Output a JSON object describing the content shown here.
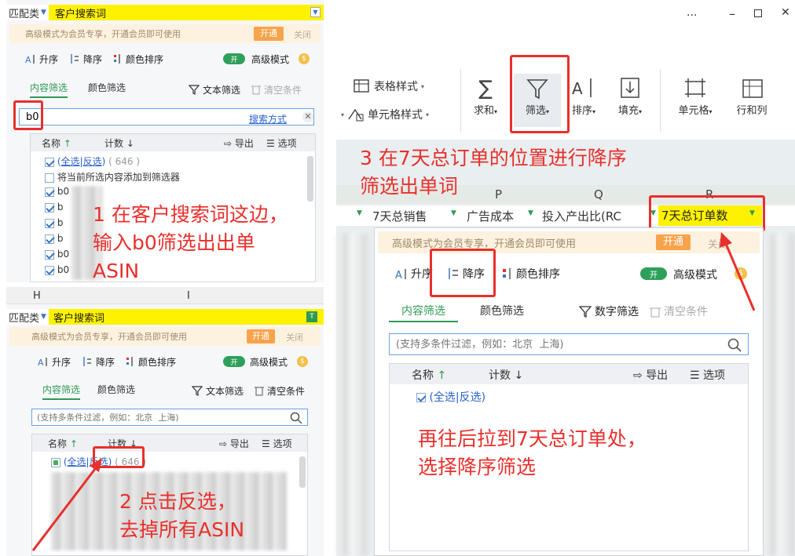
{
  "panel1": {
    "header_left": "匹配类",
    "header_title": "客户搜索词",
    "vip_text": "高级模式为会员专享，开通会员即可使用",
    "vip_open": "开通",
    "vip_close": "关闭",
    "sort_asc": "升序",
    "sort_desc": "降序",
    "color_sort": "颜色排序",
    "advanced_mode": "高级模式",
    "toggle_label": "开",
    "tab_content": "内容筛选",
    "tab_color": "颜色筛选",
    "text_filter": "文本筛选",
    "clear_conditions": "清空条件",
    "search_value": "b0",
    "search_method": "搜索方式",
    "col_name": "名称",
    "col_count": "计数",
    "export": "导出",
    "options": "选项",
    "select_all": "全选",
    "invert": "反选",
    "total_count": "646",
    "add_to_filter": "将当前所选内容添加到筛选器",
    "items": [
      "b0",
      "b",
      "b",
      "b",
      "b0",
      "b0",
      "b0"
    ]
  },
  "panel2": {
    "col_h": "H",
    "col_i": "I",
    "header_left": "匹配类",
    "header_title": "客户搜索词",
    "vip_text": "高级模式为会员专享，开通会员即可使用",
    "vip_open": "开通",
    "vip_close": "关闭",
    "sort_asc": "升序",
    "sort_desc": "降序",
    "color_sort": "颜色排序",
    "advanced_mode": "高级模式",
    "toggle_label": "开",
    "tab_content": "内容筛选",
    "tab_color": "颜色筛选",
    "text_filter": "文本筛选",
    "clear_conditions": "清空条件",
    "search_placeholder": "(支持多条件过滤，例如：北京  上海)",
    "col_name": "名称",
    "col_count": "计数",
    "export": "导出",
    "options": "选项",
    "select_all": "全选",
    "invert": "反选",
    "total_count": "646"
  },
  "panel3": {
    "window_more": "···",
    "table_style": "表格样式",
    "cell_style": "单元格样式",
    "sum": "求和",
    "filter": "筛选",
    "sort": "排序",
    "fill": "填充",
    "cell": "单元格",
    "row_col": "行和列",
    "col_p": "P",
    "col_q": "Q",
    "col_r": "R",
    "hdr_sales": "7天总销售",
    "hdr_ad_cost": "广告成本",
    "hdr_roi": "投入产出比(RC",
    "hdr_orders": "7天总订单数",
    "vip_text": "高级模式为会员专享，开通会员即可使用",
    "vip_open": "开通",
    "vip_close": "关闭",
    "sort_asc": "升序",
    "sort_desc": "降序",
    "color_sort": "颜色排序",
    "advanced_mode": "高级模式",
    "toggle_label": "开",
    "tab_content": "内容筛选",
    "tab_color": "颜色筛选",
    "number_filter": "数字筛选",
    "clear_conditions": "清空条件",
    "search_placeholder": "(支持多条件过滤，例如：北京  上海)",
    "col_name": "名称",
    "col_count": "计数",
    "export": "导出",
    "options": "选项",
    "select_all": "全选",
    "invert": "反选"
  },
  "annotations": {
    "step1": "1 在客户搜索词这边，\n输入b0筛选出出单\nASIN",
    "step2": "2 点击反选，\n去掉所有ASIN",
    "step3": "3 在7天总订单的位置进行降序\n筛选出单词",
    "step3b": "再往后拉到7天总订单处，\n选择降序筛选"
  },
  "colors": {
    "highlight_yellow": "#fff200",
    "accent_green": "#2f9a54",
    "annotation_red": "#e8302c",
    "vip_orange": "#f7a34c"
  }
}
